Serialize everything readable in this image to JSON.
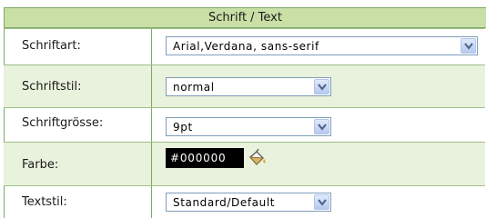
{
  "panel": {
    "title": "Schrift / Text"
  },
  "rows": [
    {
      "label": "Schriftart:",
      "value": "Arial,Verdana, sans-serif"
    },
    {
      "label": "Schriftstil:",
      "value": "normal"
    },
    {
      "label": "Schriftgrösse:",
      "value": "9pt"
    },
    {
      "label": "Farbe:",
      "value": "#000000"
    },
    {
      "label": "Textstil:",
      "value": "Standard/Default"
    }
  ],
  "icons": {
    "dropdown": "chevron-down-icon",
    "color_picker": "paint-bucket-icon"
  },
  "colors": {
    "header_bg": "#c9dfa6",
    "alt_row_bg": "#e9f2dc",
    "border": "#7da86a",
    "swatch": "#000000"
  }
}
